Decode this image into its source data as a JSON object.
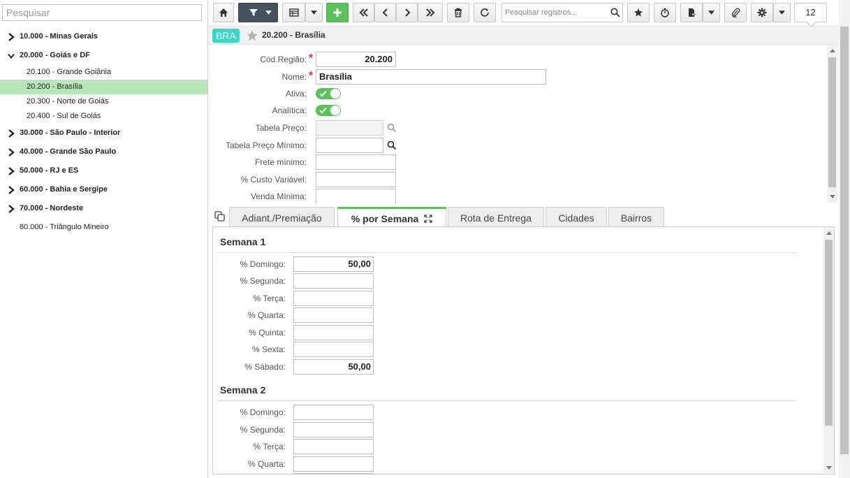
{
  "sidebar": {
    "search_placeholder": "Pesquisar",
    "tree": [
      {
        "label": "10.000 - Minas Gerais",
        "expanded": false
      },
      {
        "label": "20.000 - Goiás e DF",
        "expanded": true
      },
      {
        "label": "20.100 - Grande Goiânia"
      },
      {
        "label": "20.200 - Brasília",
        "selected": true
      },
      {
        "label": "20.300 - Norte de Goiás"
      },
      {
        "label": "20.400 - Sul de Goiás"
      },
      {
        "label": "30.000 - São Paulo - Interior",
        "expanded": false
      },
      {
        "label": "40.000 - Grande São Paulo",
        "expanded": false
      },
      {
        "label": "50.000 - RJ e ES",
        "expanded": false
      },
      {
        "label": "60.000 - Bahia e Sergipe",
        "expanded": false
      },
      {
        "label": "70.000 - Nordeste",
        "expanded": false
      },
      {
        "label": "80.000 - Triângulo Mineiro"
      }
    ]
  },
  "toolbar": {
    "search_placeholder": "Pesquisar registros...",
    "record_count": "12"
  },
  "record": {
    "badge": "BRA",
    "title": "20.200 - Brasília"
  },
  "form": {
    "cod_regiao": {
      "label": "Cód.Região:",
      "value": "20.200"
    },
    "nome": {
      "label": "Nome:",
      "value": "Brasília"
    },
    "ativa": {
      "label": "Ativa:",
      "on": true
    },
    "analitica": {
      "label": "Analítica:",
      "on": true
    },
    "tabela_preco": {
      "label": "Tabela Preço:",
      "value": ""
    },
    "tabela_preco_minimo": {
      "label": "Tabela Preço Mínimo:",
      "value": ""
    },
    "frete_minimo": {
      "label": "Frete mínimo:",
      "value": ""
    },
    "custo_variavel": {
      "label": "% Custo Variável:",
      "value": ""
    },
    "venda_minima": {
      "label": "Venda Mínima:",
      "value": ""
    }
  },
  "tabs": [
    {
      "label": "Adiant./Premiação"
    },
    {
      "label": "% por Semana",
      "active": true
    },
    {
      "label": "Rota de Entrega"
    },
    {
      "label": "Cidades"
    },
    {
      "label": "Bairros"
    }
  ],
  "weeks": [
    {
      "title": "Semana 1",
      "days": [
        {
          "label": "% Domingo:",
          "value": "50,00"
        },
        {
          "label": "% Segunda:",
          "value": ""
        },
        {
          "label": "% Terça:",
          "value": ""
        },
        {
          "label": "% Quarta:",
          "value": ""
        },
        {
          "label": "% Quinta:",
          "value": ""
        },
        {
          "label": "% Sexta:",
          "value": ""
        },
        {
          "label": "% Sábado:",
          "value": "50,00"
        }
      ]
    },
    {
      "title": "Semana 2",
      "days": [
        {
          "label": "% Domingo:",
          "value": ""
        },
        {
          "label": "% Segunda:",
          "value": ""
        },
        {
          "label": "% Terça:",
          "value": ""
        },
        {
          "label": "% Quarta:",
          "value": ""
        }
      ]
    }
  ],
  "colors": {
    "accent": "#5bc25b",
    "badge": "#3dd6c4",
    "selected": "#b8e6b8",
    "toolbar_dark": "#46525e"
  }
}
